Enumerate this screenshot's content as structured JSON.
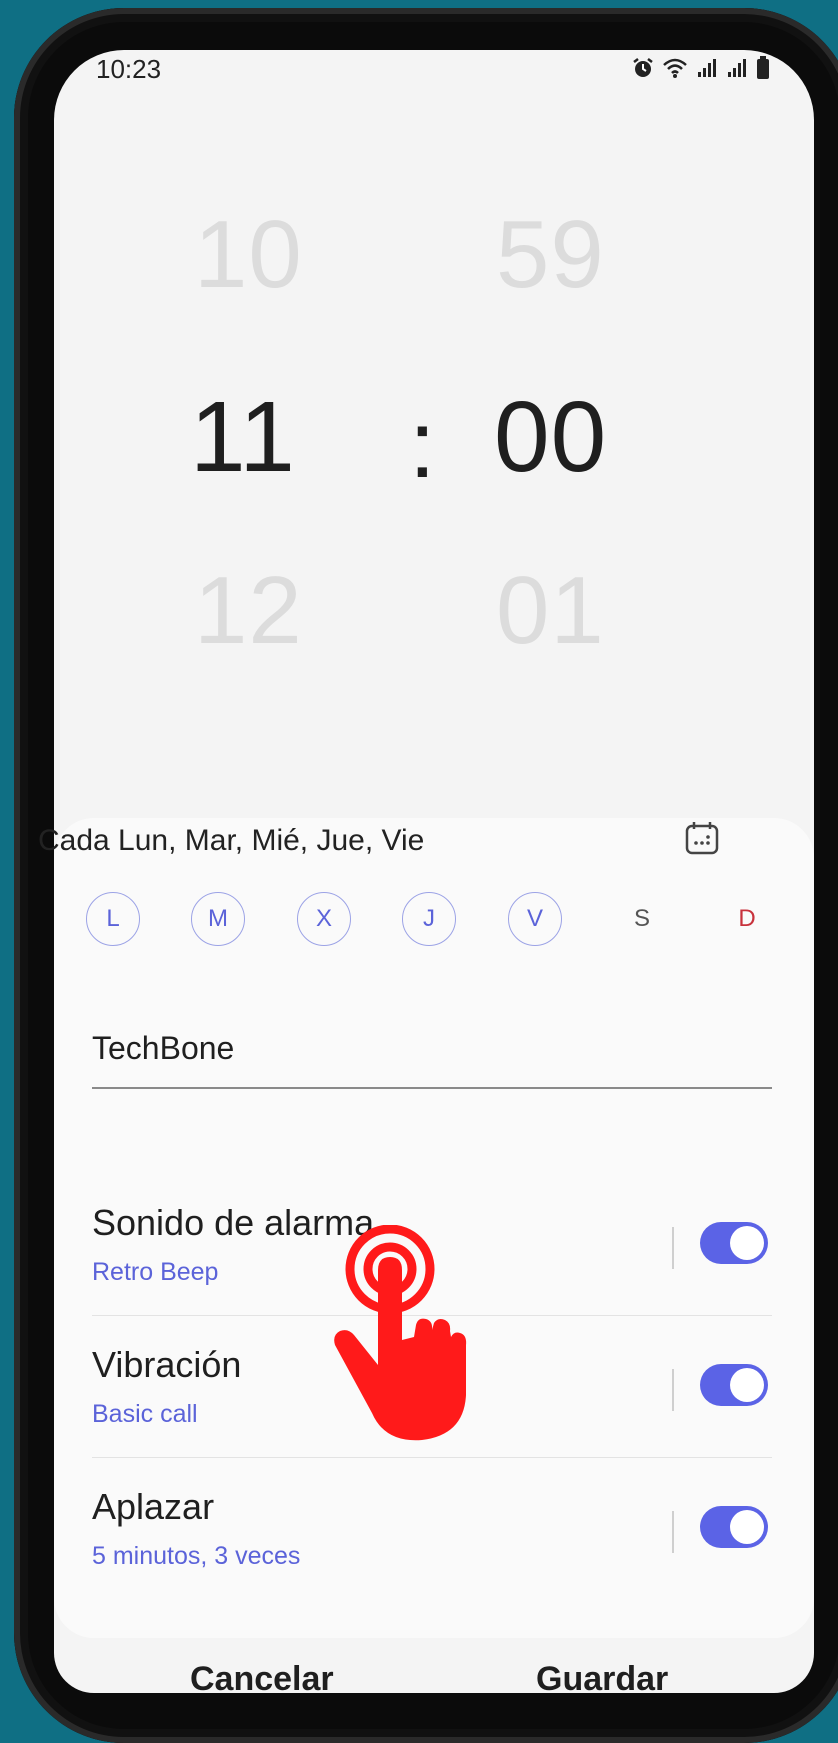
{
  "status_bar": {
    "time": "10:23",
    "icons": [
      "alarm-icon",
      "wifi-icon",
      "signal-icon",
      "signal-icon",
      "battery-icon"
    ]
  },
  "time_picker": {
    "hour_prev": "10",
    "hour": "11",
    "hour_next": "12",
    "separator": ":",
    "minute_prev": "59",
    "minute": "00",
    "minute_next": "01"
  },
  "repeat": {
    "label": "Cada Lun, Mar, Mié, Jue, Vie",
    "calendar_icon": "calendar-icon",
    "days": [
      {
        "label": "L",
        "selected": true
      },
      {
        "label": "M",
        "selected": true
      },
      {
        "label": "X",
        "selected": true
      },
      {
        "label": "J",
        "selected": true
      },
      {
        "label": "V",
        "selected": true
      },
      {
        "label": "S",
        "selected": false
      },
      {
        "label": "D",
        "selected": false
      }
    ]
  },
  "alarm_name": {
    "value": "TechBone"
  },
  "settings": [
    {
      "title": "Sonido de alarma",
      "subtitle": "Retro Beep",
      "enabled": true
    },
    {
      "title": "Vibración",
      "subtitle": "Basic call",
      "enabled": true
    },
    {
      "title": "Aplazar",
      "subtitle": "5 minutos, 3 veces",
      "enabled": true
    }
  ],
  "actions": {
    "cancel": "Cancelar",
    "save": "Guardar"
  },
  "colors": {
    "background": "#0f6f84",
    "accent": "#5b63e6",
    "sunday": "#c8323c",
    "tap_hand": "#ff1a1a"
  },
  "overlay": {
    "icon": "tap-hand-icon"
  }
}
